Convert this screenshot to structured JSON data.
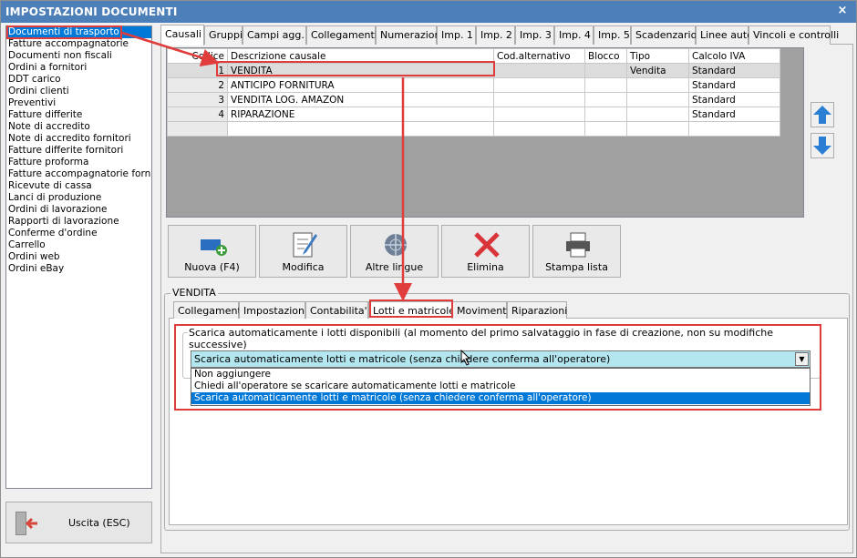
{
  "window": {
    "title": "IMPOSTAZIONI DOCUMENTI",
    "close_glyph": "×"
  },
  "left_list": {
    "items": [
      "Documenti di trasporto",
      "Fatture accompagnatorie",
      "Documenti non fiscali",
      "Ordini a fornitori",
      "DDT carico",
      "Ordini clienti",
      "Preventivi",
      "Fatture differite",
      "Note di accredito",
      "Note di accredito fornitori",
      "Fatture differite fornitori",
      "Fatture proforma",
      "Fatture accompagnatorie fornito",
      "Ricevute di cassa",
      "Lanci di produzione",
      "Ordini di lavorazione",
      "Rapporti di lavorazione",
      "Conferme d'ordine",
      "Carrello",
      "Ordini web",
      "Ordini eBay"
    ],
    "selected_index": 0
  },
  "exit_button": {
    "label": "Uscita (ESC)",
    "icon": "exit-door-icon"
  },
  "main_tabs": [
    "Causali",
    "Gruppi",
    "Campi agg.",
    "Collegamenti",
    "Numerazioni",
    "Imp. 1",
    "Imp. 2",
    "Imp. 3",
    "Imp. 4",
    "Imp. 5",
    "Scadenzario",
    "Linee auto",
    "Vincoli e controlli"
  ],
  "grid": {
    "columns": [
      "Codice",
      "Descrizione causale",
      "Cod.alternativo",
      "Blocco",
      "Tipo",
      "Calcolo IVA"
    ],
    "rows": [
      {
        "codice": "1",
        "descrizione": "VENDITA",
        "cod_alt": "",
        "blocco": "",
        "tipo": "Vendita",
        "calcolo_iva": "Standard"
      },
      {
        "codice": "2",
        "descrizione": "ANTICIPO FORNITURA",
        "cod_alt": "",
        "blocco": "",
        "tipo": "",
        "calcolo_iva": "Standard"
      },
      {
        "codice": "3",
        "descrizione": "VENDITA LOG. AMAZON",
        "cod_alt": "",
        "blocco": "",
        "tipo": "",
        "calcolo_iva": "Standard"
      },
      {
        "codice": "4",
        "descrizione": "RIPARAZIONE",
        "cod_alt": "",
        "blocco": "",
        "tipo": "",
        "calcolo_iva": "Standard"
      }
    ]
  },
  "toolbar": {
    "new": "Nuova (F4)",
    "edit": "Modifica",
    "languages": "Altre lingue",
    "delete": "Elimina",
    "print": "Stampa lista"
  },
  "detail": {
    "group_label": "VENDITA",
    "tabs": [
      "Collegamenti",
      "Impostazioni",
      "Contabilita'",
      "Lotti e matricole",
      "Movimenti",
      "Riparazioni"
    ],
    "active_tab": "Lotti e matricole",
    "lots_group_label": "Scarica automaticamente i lotti disponibili (al momento del primo salvataggio in fase di creazione, non su modifiche successive)",
    "combo_value": "Scarica automaticamente lotti e matricole (senza chiedere conferma all'operatore)",
    "options": [
      "Non aggiungere",
      "Chiedi all'operatore se scaricare automaticamente lotti e matricole",
      "Scarica automaticamente lotti e matricole (senza chiedere conferma all'operatore)"
    ],
    "selected_option_index": 2
  },
  "colors": {
    "title_bar": "#4d7fb8",
    "selection": "#0078d7",
    "annotation": "#e03c3c",
    "combo_bg": "#b4e6f0"
  }
}
